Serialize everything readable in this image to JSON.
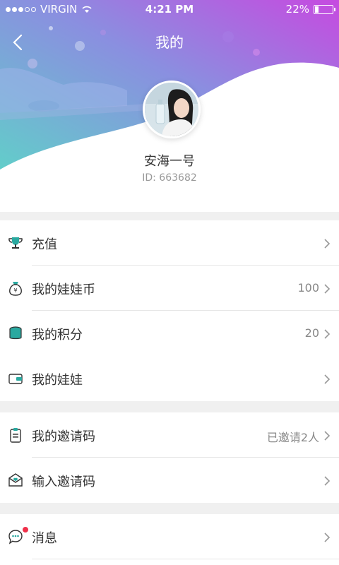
{
  "status": {
    "carrier": "VIRGIN",
    "time": "4:21 PM",
    "battery": "22%"
  },
  "nav": {
    "title": "我的"
  },
  "profile": {
    "name": "安海一号",
    "id": "ID: 663682"
  },
  "menu": {
    "recharge": {
      "label": "充值"
    },
    "coins": {
      "label": "我的娃娃币",
      "value": "100"
    },
    "points": {
      "label": "我的积分",
      "value": "20"
    },
    "dolls": {
      "label": "我的娃娃"
    },
    "invite_code": {
      "label": "我的邀请码",
      "value": "已邀请2人"
    },
    "enter_code": {
      "label": "输入邀请码"
    },
    "messages": {
      "label": "消息"
    }
  },
  "colors": {
    "gradient_start": "#5fd2c8",
    "gradient_end": "#c64ae0",
    "icon_teal": "#2aa9a0",
    "badge": "#f0304a"
  },
  "icons": {
    "recharge": "trophy-icon",
    "coins": "money-bag-icon",
    "points": "coin-stack-icon",
    "dolls": "wallet-icon",
    "invite_code": "clipboard-icon",
    "enter_code": "envelope-icon",
    "messages": "chat-bubble-icon"
  }
}
